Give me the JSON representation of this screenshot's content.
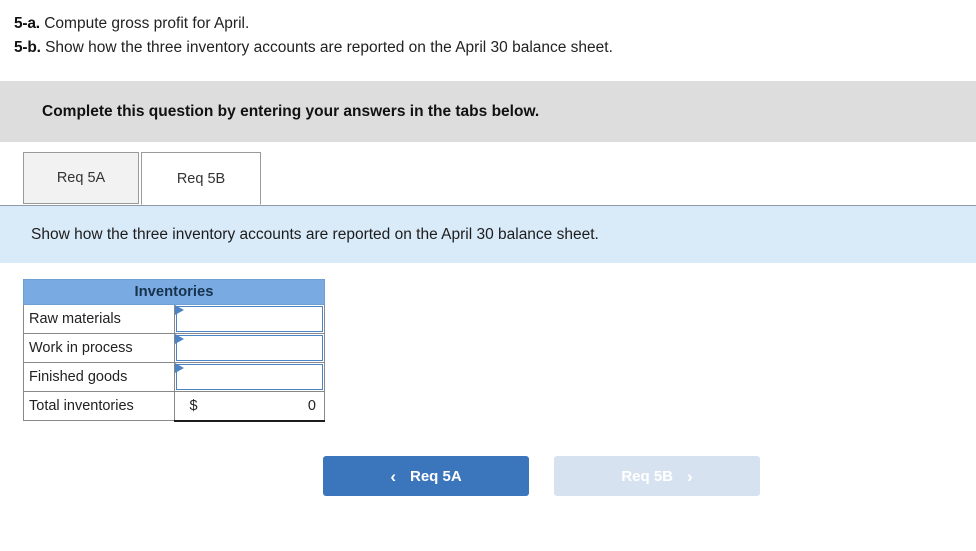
{
  "question": {
    "lines": [
      {
        "label": "5-a.",
        "text": "Compute gross profit for April."
      },
      {
        "label": "5-b.",
        "text": "Show how the three inventory accounts are reported on the April 30 balance sheet."
      }
    ]
  },
  "gray_banner": {
    "text": "Complete this question by entering your answers in the tabs below."
  },
  "tabs": [
    {
      "label": "Req 5A",
      "active": false
    },
    {
      "label": "Req 5B",
      "active": true
    }
  ],
  "blue_banner": {
    "text": "Show how the three inventory accounts are reported on the April 30 balance sheet."
  },
  "table": {
    "header": "Inventories",
    "rows": [
      {
        "label": "Raw materials",
        "value": ""
      },
      {
        "label": "Work in process",
        "value": ""
      },
      {
        "label": "Finished goods",
        "value": ""
      }
    ],
    "total": {
      "label": "Total inventories",
      "currency": "$",
      "value": "0"
    }
  },
  "nav": {
    "prev": {
      "label": "Req 5A",
      "icon": "chevron-left-icon",
      "glyph": "‹"
    },
    "next": {
      "label": "Req 5B",
      "icon": "chevron-right-icon",
      "glyph": "›"
    }
  },
  "colors": {
    "gray_banner_bg": "#dddddd",
    "blue_banner_bg": "#d9eaf8",
    "table_header_bg": "#79abe2",
    "input_border": "#4a84c4",
    "primary_button_bg": "#3b76bc",
    "disabled_button_bg": "#d7e2f1"
  }
}
